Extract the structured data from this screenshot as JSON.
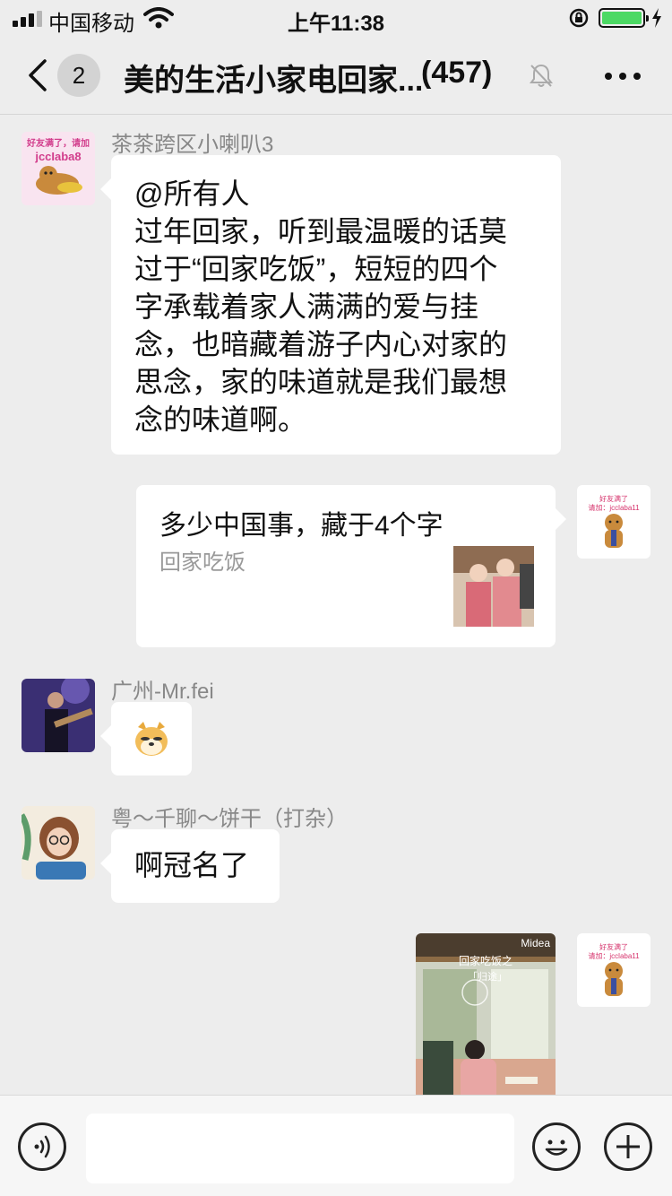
{
  "status_bar": {
    "carrier": "中国移动",
    "time": "上午11:38"
  },
  "nav": {
    "unread_badge": "2",
    "title": "美的生活小家电回家...",
    "member_count": "(457)"
  },
  "messages": [
    {
      "sender": "茶茶跨区小喇叭3",
      "avatar_text": [
        "好友满了，请加",
        "jccIaba8"
      ],
      "lines": [
        "@所有人",
        "过年回家，听到最温暖的话莫",
        "过于“回家吃饭”，短短的四个",
        "字承载着家人满满的爱与挂",
        "念，也暗藏着游子内心对家的",
        "思念，家的味道就是我们最想",
        "念的味道啊。"
      ]
    },
    {
      "avatar_text": [
        "好友满了",
        "请加：jcclaba11"
      ],
      "card_title": "多少中国事，藏于4个字",
      "card_desc": "回家吃饭"
    },
    {
      "sender": "广州-Mr.fei"
    },
    {
      "sender": "粤～千聊～饼干（打杂）",
      "text": "啊冠名了"
    },
    {
      "avatar_text": [
        "好友满了",
        "请加：jcclaba11"
      ],
      "poster_brand": "Midea",
      "poster_title": "回家吃饭之",
      "poster_subtitle": "「归途」"
    }
  ]
}
